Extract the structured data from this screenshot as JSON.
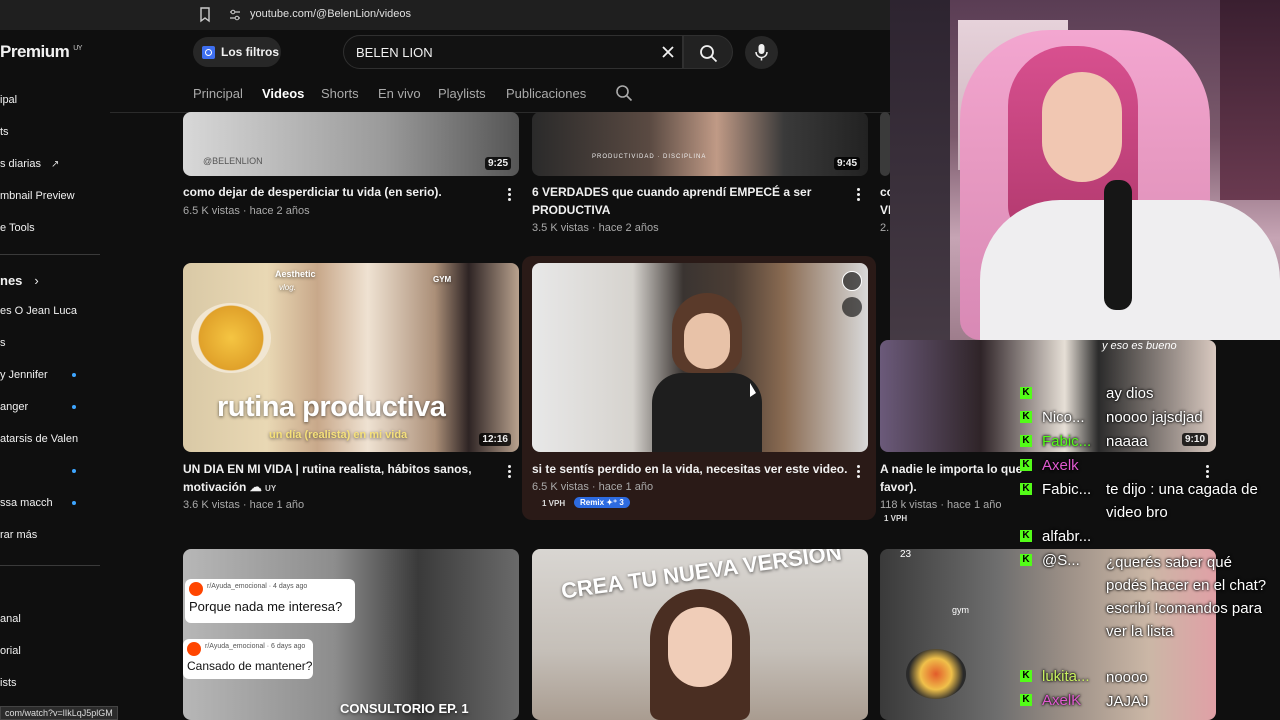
{
  "browser": {
    "url": "youtube.com/@BelenLion/videos"
  },
  "sidebar": {
    "brand": "Premium",
    "brand_region": "UY",
    "items": [
      {
        "label": "ipal"
      },
      {
        "label": "ts"
      },
      {
        "label": "s diarias"
      },
      {
        "label": "mbnail Preview"
      },
      {
        "label": "e Tools"
      }
    ],
    "section_title": "nes",
    "subs": [
      {
        "label": "es O Jean Luca"
      },
      {
        "label": "s"
      },
      {
        "label": "y Jennifer"
      },
      {
        "label": "anger"
      },
      {
        "label": "atarsis de Valen"
      },
      {
        "label": ""
      },
      {
        "label": "ssa macch"
      },
      {
        "label": "rar más"
      }
    ],
    "bottom": [
      {
        "label": "anal"
      },
      {
        "label": "orial"
      },
      {
        "label": "ists"
      }
    ]
  },
  "status_url": "com/watch?v=lIkLqJ5plGM",
  "header": {
    "filters_label": "Los filtros",
    "search_value": "BELEN LION"
  },
  "tabs": [
    "Principal",
    "Videos",
    "Shorts",
    "En vivo",
    "Playlists",
    "Publicaciones"
  ],
  "videos": [
    {
      "title": "como dejar de desperdiciar tu vida (en serio).",
      "meta": "6.5 K vistas · hace 2 años",
      "duration": "9:25",
      "thumb_text": "@BELENLION"
    },
    {
      "title_l1": "6 VERDADES que cuando aprendí EMPECÉ a ser",
      "title_l2": "PRODUCTIVA",
      "meta": "3.5 K vistas · hace 2 años",
      "duration": "9:45",
      "thumb_text": "PRODUCTIVIDAD · DISCIPLINA"
    },
    {
      "title": "co",
      "title_l2": "VI",
      "meta": "2."
    },
    {
      "title_l1": "UN DIA EN MI VIDA | rutina realista, hábitos sanos,",
      "title_l2": "motivación",
      "region": "UY",
      "meta": "3.6 K vistas · hace 1 año",
      "duration": "12:16",
      "thumb_main": "rutina productiva",
      "thumb_sub": "un día (realista) en mi vida",
      "thumb_tag1": "Aesthetic",
      "thumb_tag2": "vlog.",
      "thumb_tag3": "GYM"
    },
    {
      "title": "si te sentís perdido en la vida, necesitas ver este video.",
      "meta": "6.5 K vistas · hace 1 año",
      "vph": "1 VPH",
      "remix": "Remix ✦⁺ 3"
    },
    {
      "title_l1": "A nadie le importa lo que",
      "title_l2": "favor).",
      "meta": "118 k vistas · hace 1 año",
      "vph": "1 VPH",
      "duration": "9:10",
      "thumb_text": "y eso es bueno"
    },
    {
      "reddit_sub": "r/Ayuda_emocional",
      "reddit_time1": "4 days ago",
      "reddit_q1": "Porque nada me interesa?",
      "reddit_time2": "6 days ago",
      "reddit_q2": "Cansado de mantener?",
      "thumb_text": "CONSULTORIO EP. 1"
    },
    {
      "thumb_text": "CREA TU NUEVA VERSIÓN"
    },
    {
      "thumb_text": "gym",
      "thumb_num": "23"
    }
  ],
  "chat": [
    {
      "user": "",
      "msg": "ay dios"
    },
    {
      "user": "Nico...",
      "msg": "noooo jajsdjad"
    },
    {
      "user": "Fabic...",
      "msg": "naaaa"
    },
    {
      "user": "Axelk",
      "msg": ""
    },
    {
      "user": "Fabic...",
      "msg": "te dijo : una cagada de video bro"
    },
    {
      "user": "alfabr...",
      "msg": ""
    },
    {
      "user": "@S...",
      "msg": "¿querés saber qué podés hacer en el chat? escribí !comandos para ver la lista"
    },
    {
      "user": "lukita...",
      "msg": "noooo"
    },
    {
      "user": "AxelK",
      "msg": "JAJAJ"
    }
  ],
  "colors": {
    "background": "#0f0f0f",
    "accent": "#3ea6ff",
    "kick": "#53fc18",
    "remix": "#2d6be0"
  }
}
